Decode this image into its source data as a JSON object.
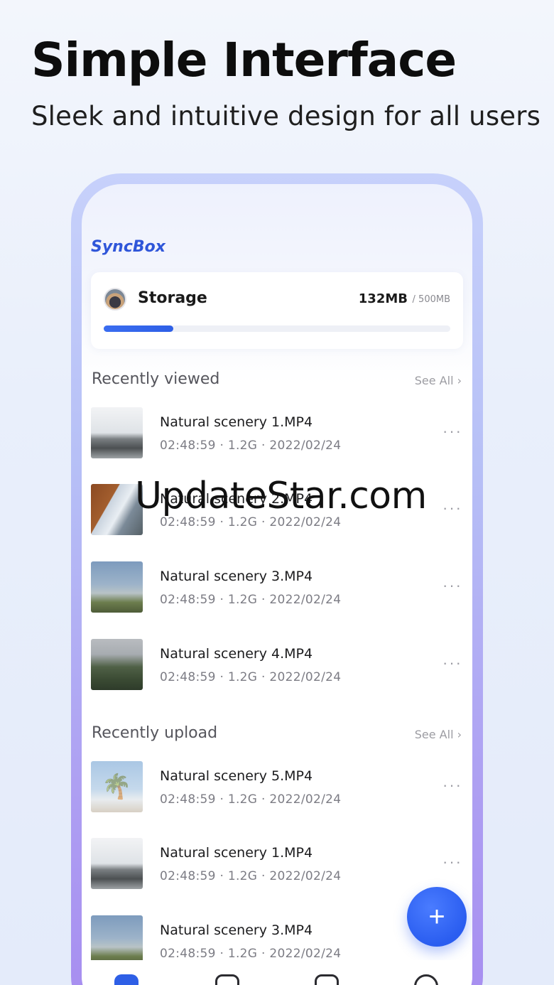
{
  "promo": {
    "headline": "Simple Interface",
    "subline": "Sleek and intuitive design for all users"
  },
  "app": {
    "title": "SyncBox"
  },
  "storage": {
    "label": "Storage",
    "used": "132MB",
    "total": "/ 500MB",
    "progress_fraction": 0.2
  },
  "recently_viewed": {
    "title": "Recently viewed",
    "see_all": "See All ›",
    "items": [
      {
        "name": "Natural scenery 1.MP4",
        "meta": "02:48:59 · 1.2G · 2022/02/24",
        "thumb": "city"
      },
      {
        "name": "Natural scenery 2.MP4",
        "meta": "02:48:59 · 1.2G · 2022/02/24",
        "thumb": "hut"
      },
      {
        "name": "Natural scenery 3.MP4",
        "meta": "02:48:59 · 1.2G · 2022/02/24",
        "thumb": "rainbow"
      },
      {
        "name": "Natural scenery 4.MP4",
        "meta": "02:48:59 · 1.2G · 2022/02/24",
        "thumb": "hills"
      }
    ]
  },
  "recently_upload": {
    "title": "Recently upload",
    "see_all": "See All ›",
    "items": [
      {
        "name": "Natural scenery 5.MP4",
        "meta": "02:48:59 · 1.2G · 2022/02/24",
        "thumb": "palm"
      },
      {
        "name": "Natural scenery 1.MP4",
        "meta": "02:48:59 · 1.2G · 2022/02/24",
        "thumb": "city"
      },
      {
        "name": "Natural scenery 3.MP4",
        "meta": "02:48:59 · 1.2G · 2022/02/24",
        "thumb": "rainbow"
      }
    ]
  },
  "fab": {
    "icon": "plus-icon",
    "glyph": "+"
  },
  "tabbar": {
    "tabs": [
      {
        "icon": "home-icon",
        "active": true
      },
      {
        "icon": "folder-icon",
        "active": false
      },
      {
        "icon": "transfer-icon",
        "active": false
      },
      {
        "icon": "profile-icon",
        "active": false
      }
    ]
  },
  "watermark": "UpdateStar.com",
  "colors": {
    "accent": "#2e5fe6",
    "brand": "#2f56d9"
  }
}
